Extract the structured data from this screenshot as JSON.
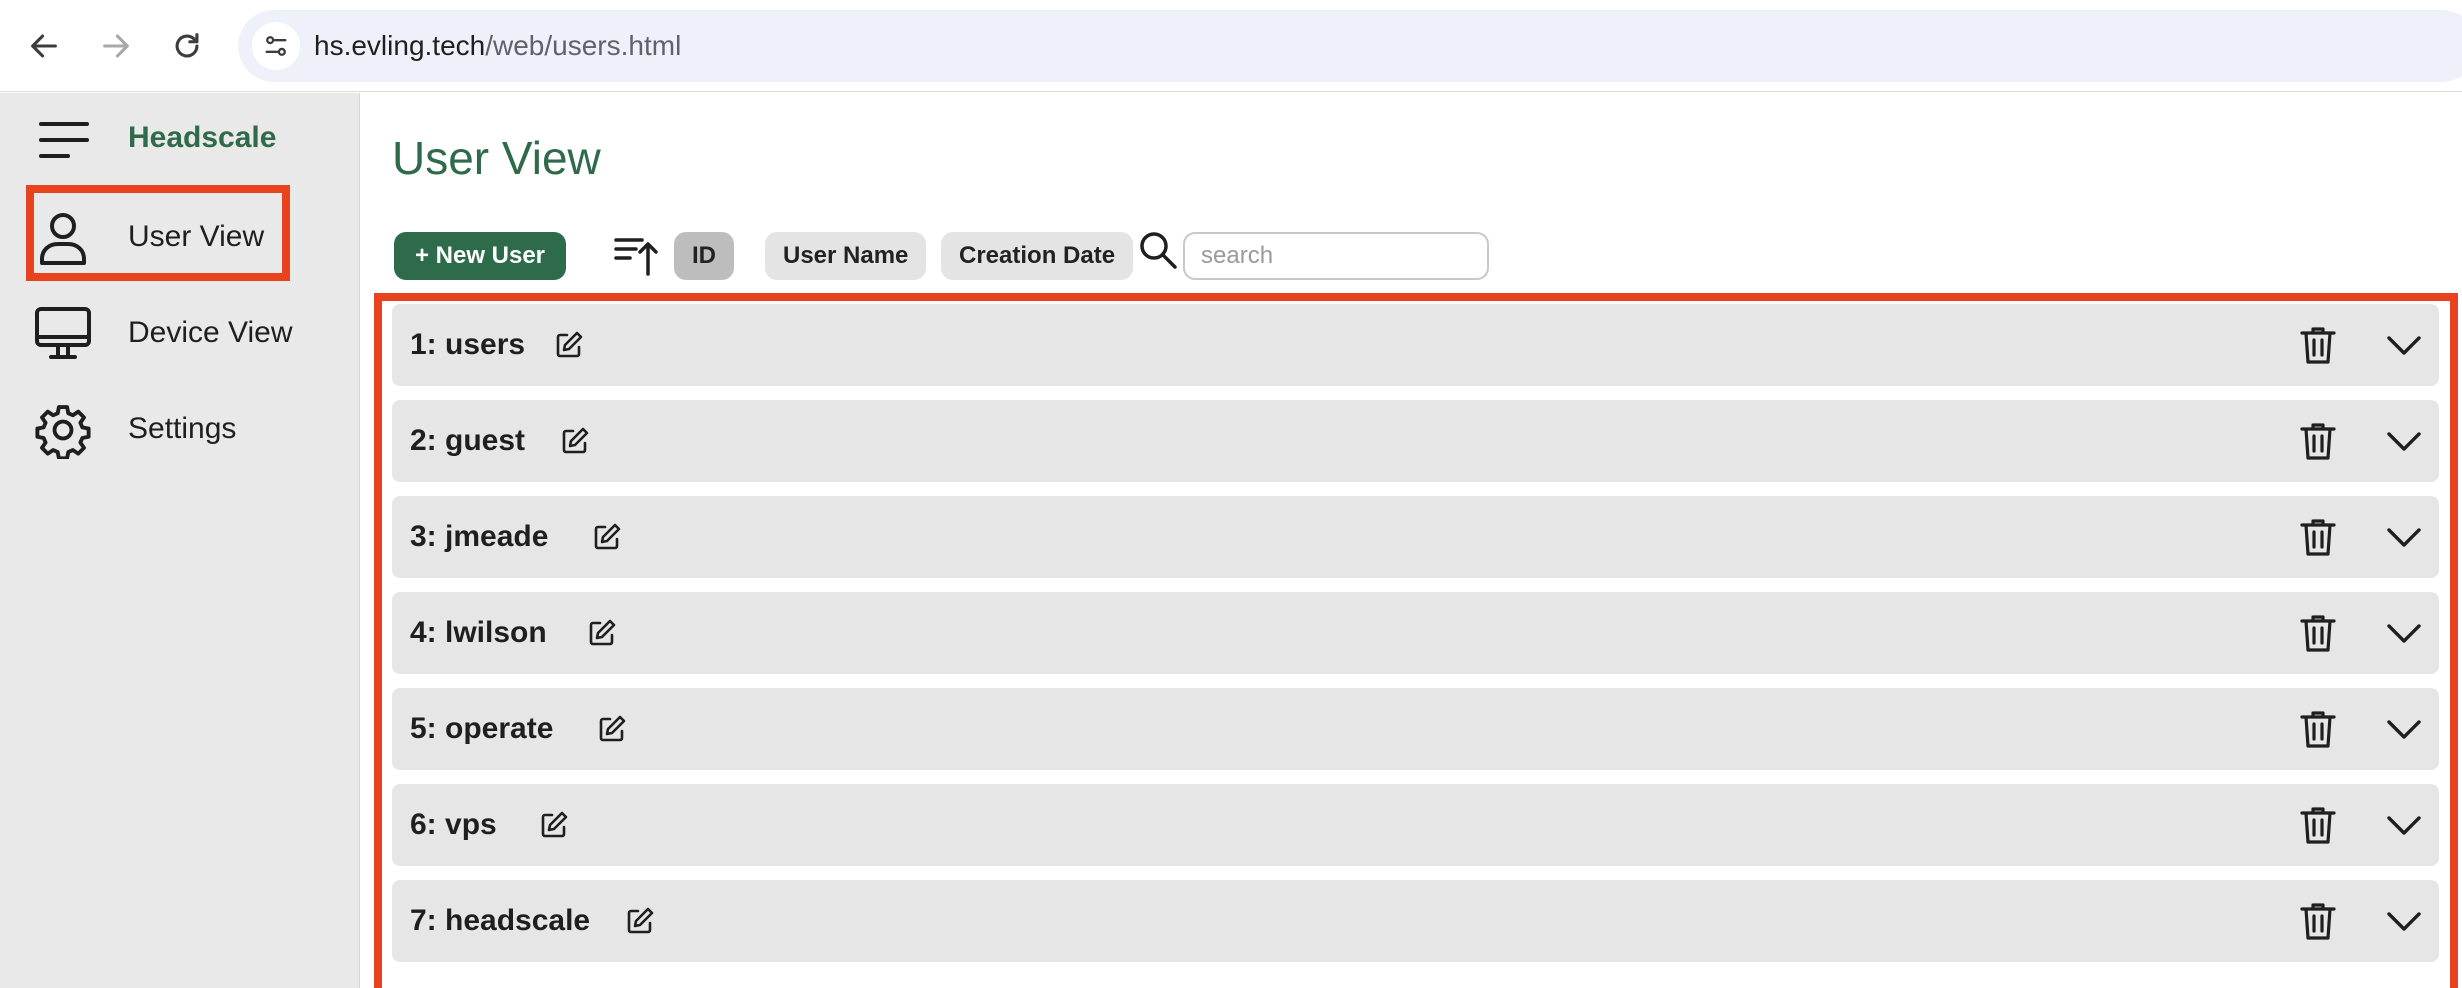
{
  "browser": {
    "url_host": "hs.evling.tech",
    "url_path": "/web/users.html"
  },
  "sidebar": {
    "brand": "Headscale",
    "items": [
      {
        "label": "User View",
        "icon": "person-icon",
        "active": true
      },
      {
        "label": "Device View",
        "icon": "monitor-icon",
        "active": false
      },
      {
        "label": "Settings",
        "icon": "gear-icon",
        "active": false
      }
    ]
  },
  "main": {
    "title": "User View",
    "new_user_label": "+ New User",
    "sort": {
      "options": [
        "ID",
        "User Name",
        "Creation Date"
      ],
      "active": "ID"
    },
    "search": {
      "placeholder": "search",
      "value": ""
    },
    "users": [
      {
        "label": "1: users"
      },
      {
        "label": "2: guest"
      },
      {
        "label": "3: jmeade"
      },
      {
        "label": "4: lwilson"
      },
      {
        "label": "5: operate"
      },
      {
        "label": "6: vps"
      },
      {
        "label": "7: headscale"
      }
    ]
  },
  "colors": {
    "accent": "#2e6b4b",
    "highlight": "#e8421f",
    "row_bg": "#e6e6e6",
    "sidebar_bg": "#e9e9e9"
  }
}
